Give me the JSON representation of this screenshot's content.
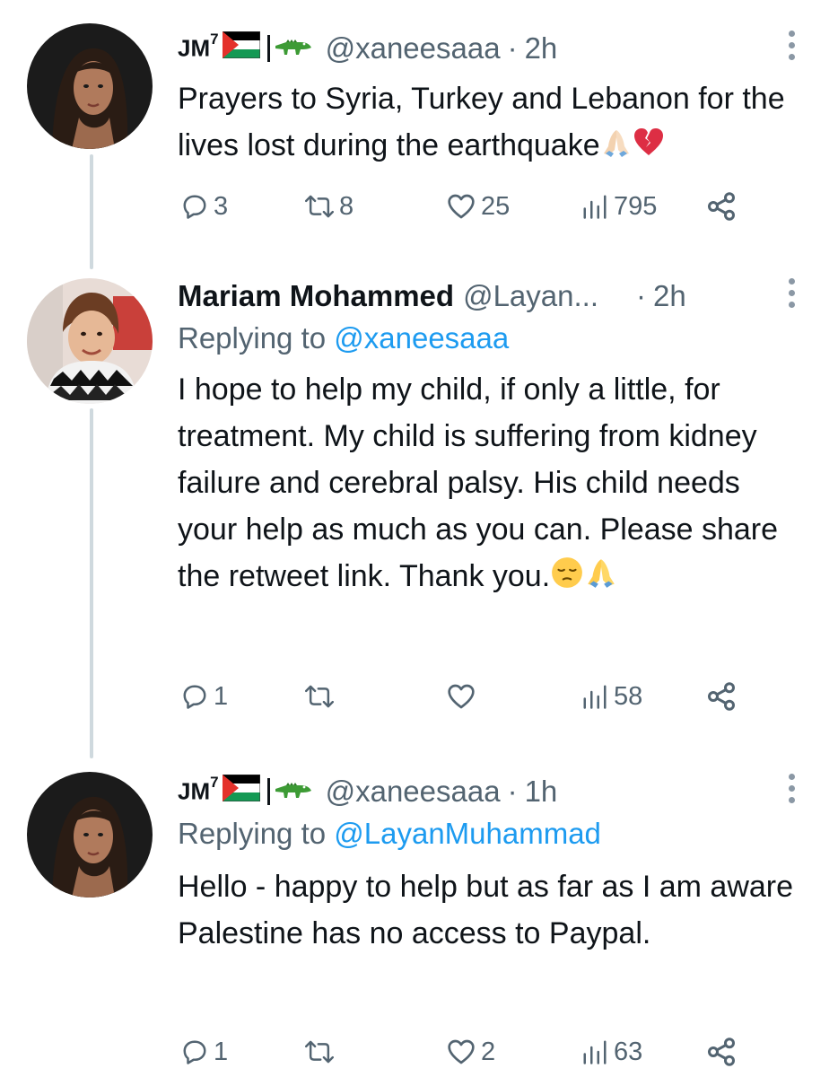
{
  "tweets": [
    {
      "author": {
        "name": "JM",
        "name_superscript": "7",
        "handle": "@xaneesaaa",
        "avatar_icon": "woman-portrait-avatar"
      },
      "dot": "·",
      "time": "2h",
      "text": "Prayers to Syria, Turkey and Lebanon for the lives lost during the earthquake",
      "text_emojis": [
        "folded-hands-icon",
        "broken-heart-icon"
      ],
      "stats": {
        "replies": "3",
        "retweets": "8",
        "likes": "25",
        "views": "795"
      }
    },
    {
      "author": {
        "name": "Mariam Mohammed",
        "handle": "@Layan...",
        "avatar_icon": "child-in-keffiyeh-avatar"
      },
      "dot": "·",
      "time": "2h",
      "replying_prefix": "Replying to ",
      "replying_to": "@xaneesaaa",
      "text": "I hope to help my child, if only a little, for treatment. My child is suffering from kidney failure and cerebral palsy. His child needs your help as much as you can. Please share the retweet link. Thank you.",
      "text_emojis": [
        "pensive-face-icon",
        "folded-hands-icon"
      ],
      "stats": {
        "replies": "1",
        "retweets": "",
        "likes": "",
        "views": "58"
      }
    },
    {
      "author": {
        "name": "JM",
        "name_superscript": "7",
        "handle": "@xaneesaaa",
        "avatar_icon": "woman-portrait-avatar"
      },
      "dot": "·",
      "time": "1h",
      "replying_prefix": "Replying to ",
      "replying_to": "@LayanMuhammad",
      "text": "Hello - happy to help but as far as I am aware Palestine has no access to Paypal.",
      "stats": {
        "replies": "1",
        "retweets": "",
        "likes": "2",
        "views": "63"
      }
    }
  ],
  "colors": {
    "text_primary": "#0f1419",
    "text_secondary": "#536471",
    "link": "#1d9bf0",
    "thread_line": "#cfd9de"
  },
  "name_decor_icons": [
    "palestine-flag-icon",
    "crocodile-icon"
  ]
}
